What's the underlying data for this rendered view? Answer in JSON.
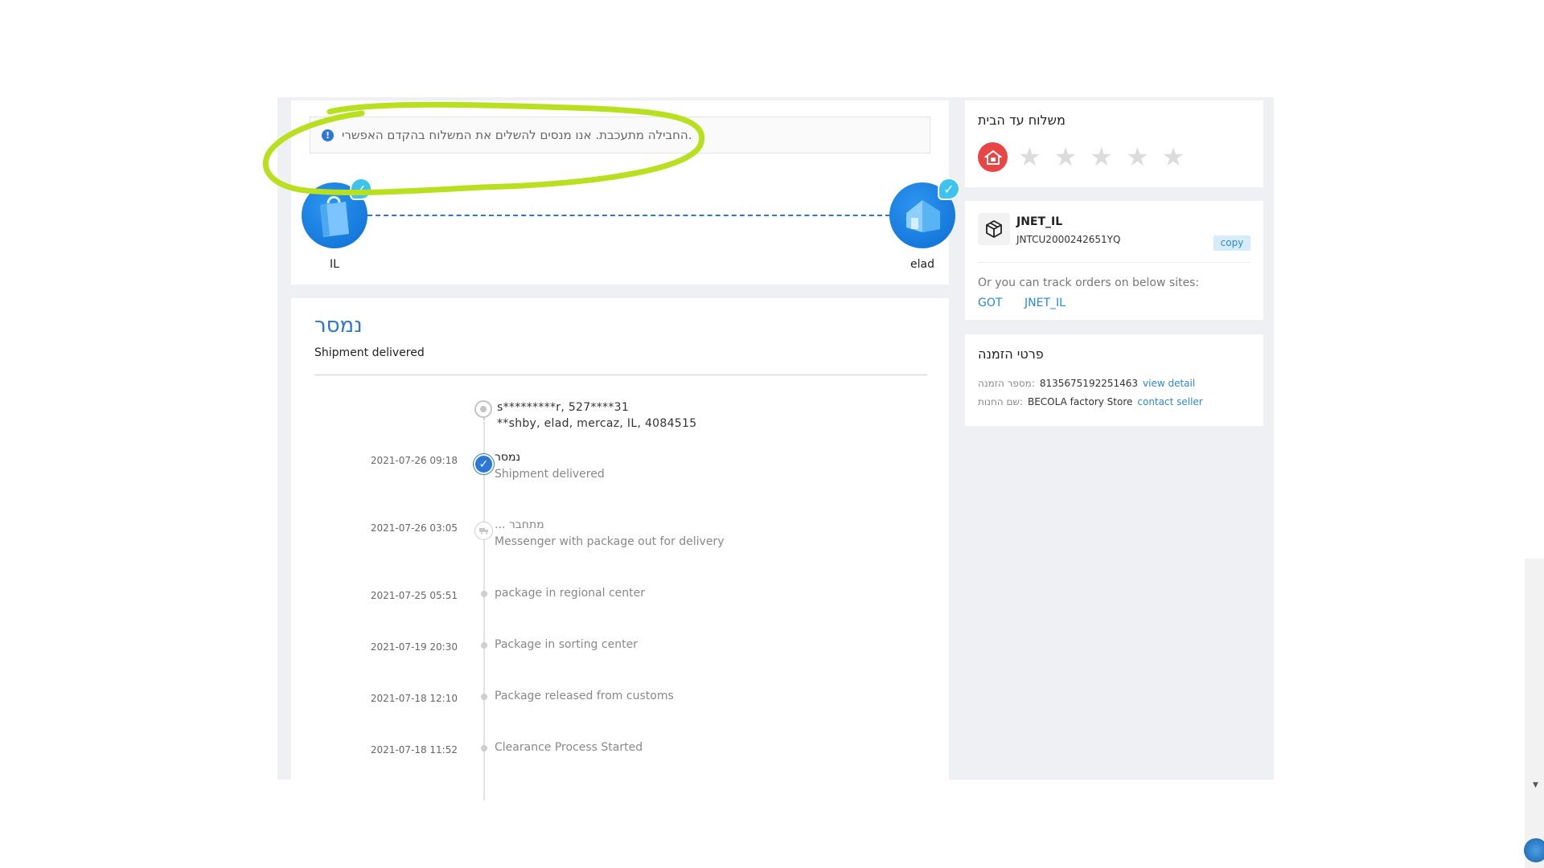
{
  "journey": {
    "notice_icon": "!",
    "notice_text": "החבילה מתעכבת. אנו מנסים להשלים את המשלוח בהקדם האפשרי.",
    "origin_label": "IL",
    "destination_label": "elad"
  },
  "status": {
    "title": "נמסר",
    "subtitle": "Shipment delivered"
  },
  "address": {
    "line1": "s*********r,  527****31",
    "line2": "**shby,  elad,  mercaz,  IL,  4084515"
  },
  "events": [
    {
      "time": "2021-07-26 09:18",
      "title": "נמסר",
      "desc": "Shipment delivered"
    },
    {
      "time": "2021-07-26 03:05",
      "title": "... מתחבר",
      "desc": "Messenger with package out for delivery"
    },
    {
      "time": "2021-07-25 05:51",
      "title": "",
      "desc": "package in regional center"
    },
    {
      "time": "2021-07-19 20:30",
      "title": "",
      "desc": "Package in sorting center"
    },
    {
      "time": "2021-07-18 12:10",
      "title": "",
      "desc": "Package released from customs"
    },
    {
      "time": "2021-07-18 11:52",
      "title": "",
      "desc": "Clearance Process Started"
    }
  ],
  "rating": {
    "title": "משלוח עד הבית",
    "home_icon": "home-icon",
    "stars_filled": 0,
    "stars_total": 5
  },
  "carrier": {
    "name": "JNET_IL",
    "tracking_number": "JNTCU2000242651YQ",
    "copy_label": "copy",
    "track_note": "Or you can track orders on below sites:",
    "links": [
      "GOT",
      "JNET_IL"
    ]
  },
  "order": {
    "title": "פרטי הזמנה",
    "order_no_label": "מספר הזמנה:",
    "order_no": "8135675192251463",
    "view_detail": "view detail",
    "store_label": "שם החנות:",
    "store_name": "BECOLA factory Store",
    "contact_seller": "contact seller"
  },
  "colors": {
    "accent": "#2b78d6",
    "highlight": "#b8e01e",
    "home_badge": "#e94545"
  }
}
